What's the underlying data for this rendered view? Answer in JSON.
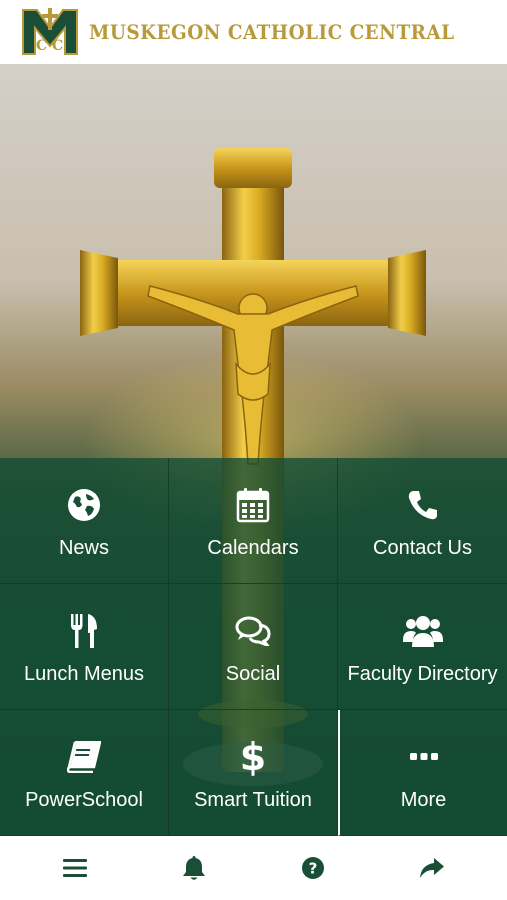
{
  "header": {
    "school_name": "MUSKEGON CATHOLIC CENTRAL",
    "logo_icon": "mcc-monogram-logo"
  },
  "colors": {
    "brand_green": "#1b4e36",
    "brand_gold": "#b89a3a",
    "tile_bg": "rgba(20,78,52,0.80)",
    "toolbar_icon": "#1b4e36"
  },
  "tiles": [
    {
      "label": "News",
      "icon": "globe-icon"
    },
    {
      "label": "Calendars",
      "icon": "calendar-icon"
    },
    {
      "label": "Contact Us",
      "icon": "phone-icon"
    },
    {
      "label": "Lunch Menus",
      "icon": "utensils-icon"
    },
    {
      "label": "Social",
      "icon": "chat-bubbles-icon"
    },
    {
      "label": "Faculty Directory",
      "icon": "users-icon"
    },
    {
      "label": "PowerSchool",
      "icon": "book-icon"
    },
    {
      "label": "Smart Tuition",
      "icon": "dollar-icon",
      "glyph": "$"
    },
    {
      "label": "More",
      "icon": "ellipsis-icon"
    }
  ],
  "toolbar": [
    {
      "icon": "menu-icon"
    },
    {
      "icon": "bell-icon"
    },
    {
      "icon": "help-icon"
    },
    {
      "icon": "share-icon"
    }
  ]
}
